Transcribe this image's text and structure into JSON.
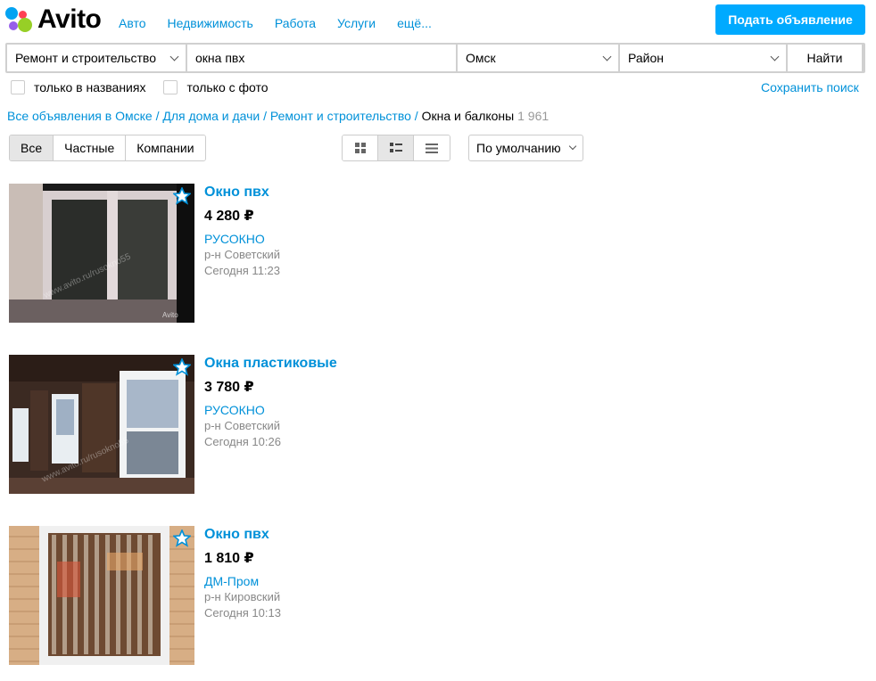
{
  "header": {
    "logo_text": "Avito",
    "nav": [
      "Авто",
      "Недвижимость",
      "Работа",
      "Услуги",
      "ещё..."
    ],
    "post_button": "Подать объявление",
    "accent": "#00aaff",
    "link_color": "#0091d9"
  },
  "search": {
    "category": "Ремонт и строительство",
    "query": "окна пвх",
    "city": "Омск",
    "district": "Район",
    "find_button": "Найти"
  },
  "options": {
    "names_only": "только в названиях",
    "with_photo": "только с фото",
    "save_search": "Сохранить поиск"
  },
  "breadcrumb": {
    "items": [
      "Все объявления в Омске",
      "Для дома и дачи",
      "Ремонт и строительство"
    ],
    "current": "Окна и балконы",
    "count": "1 961"
  },
  "filters": {
    "seller_types": [
      "Все",
      "Частные",
      "Компании"
    ],
    "active_seller_type": "Все",
    "view_modes": [
      "grid-icon",
      "list-icon",
      "compact-list-icon"
    ],
    "active_view": "list-icon",
    "sort": "По умолчанию"
  },
  "listings": [
    {
      "title": "Окно пвх",
      "price": "4 280 ₽",
      "seller": "РУСОКНО",
      "district": "р-н Советский",
      "date": "Сегодня 11:23"
    },
    {
      "title": "Окна пластиковые",
      "price": "3 780 ₽",
      "seller": "РУСОКНО",
      "district": "р-н Советский",
      "date": "Сегодня 10:26"
    },
    {
      "title": "Окно пвх",
      "price": "1 810 ₽",
      "seller": "ДМ-Пром",
      "district": "р-н Кировский",
      "date": "Сегодня 10:13"
    }
  ]
}
